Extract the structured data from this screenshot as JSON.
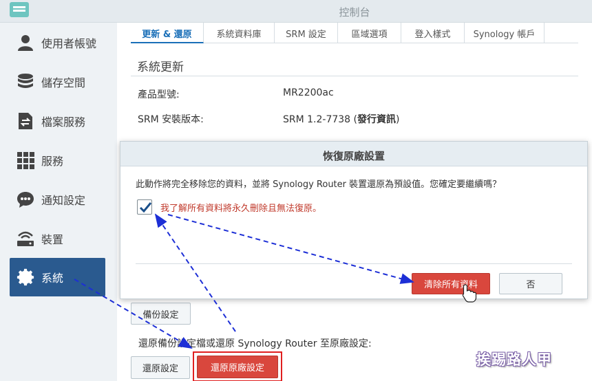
{
  "window": {
    "title": "控制台"
  },
  "sidebar": {
    "items": [
      {
        "label": "使用者帳號",
        "icon": "user-icon"
      },
      {
        "label": "儲存空間",
        "icon": "database-icon"
      },
      {
        "label": "檔案服務",
        "icon": "file-transfer-icon"
      },
      {
        "label": "服務",
        "icon": "grid-icon"
      },
      {
        "label": "通知設定",
        "icon": "chat-bubble-icon"
      },
      {
        "label": "裝置",
        "icon": "router-icon"
      },
      {
        "label": "系統",
        "icon": "gear-icon",
        "active": true
      }
    ]
  },
  "tabs": [
    "更新 & 還原",
    "系統資料庫",
    "SRM 設定",
    "區域選項",
    "登入樣式",
    "Synology 帳戶"
  ],
  "section": {
    "title": "系統更新",
    "model_label": "產品型號:",
    "model_value": "MR2200ac",
    "version_label": "SRM 安裝版本:",
    "version_value": "SRM 1.2-7738 (",
    "version_link": "發行資訊",
    "version_close": ")"
  },
  "backup": {
    "backup_button": "備份設定",
    "restore_desc": "還原備份設定檔或還原 Synology Router 至原廠設定:",
    "restore_button": "還原設定",
    "factory_button": "還原原廠設定"
  },
  "modal": {
    "title": "恢復原廠設置",
    "message": "此動作將完全移除您的資料，並將 Synology Router 裝置還原為預設值。您確定要繼續嗎？",
    "checkbox_label": "我了解所有資料將永久刪除且無法復原。",
    "checkbox_checked": true,
    "confirm_button": "清除所有資料",
    "cancel_button": "否"
  },
  "watermark": "挨踢路人甲",
  "colors": {
    "accent": "#2a5a8f",
    "danger": "#d9473d",
    "link": "#1a6fb8",
    "annotation": "#1d2fd6"
  }
}
